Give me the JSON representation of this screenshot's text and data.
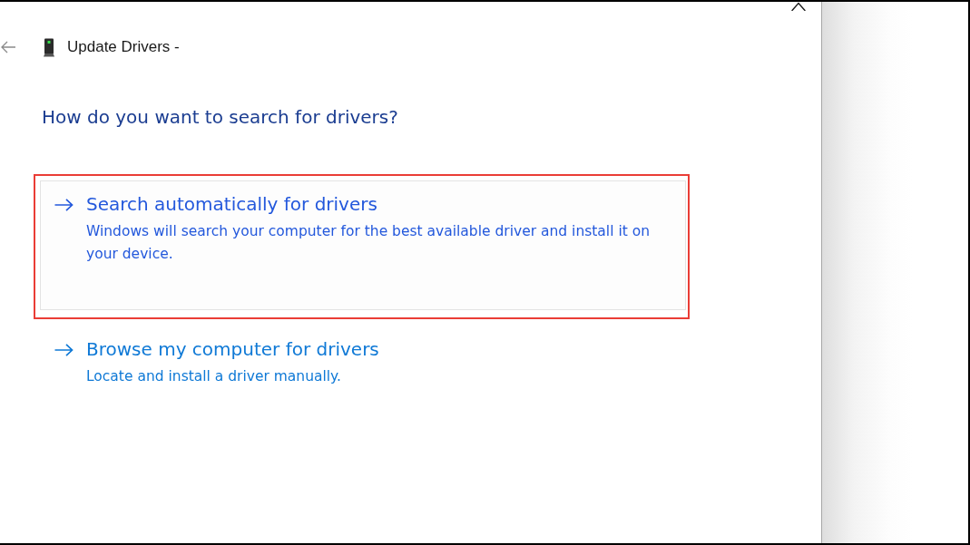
{
  "window": {
    "title": "Update Drivers -"
  },
  "heading": "How do you want to search for drivers?",
  "options": [
    {
      "title": "Search automatically for drivers",
      "description": "Windows will search your computer for the best available driver and install it on your device.",
      "selected": true,
      "highlighted": true
    },
    {
      "title": "Browse my computer for drivers",
      "description": "Locate and install a driver manually.",
      "selected": false,
      "highlighted": false
    }
  ]
}
